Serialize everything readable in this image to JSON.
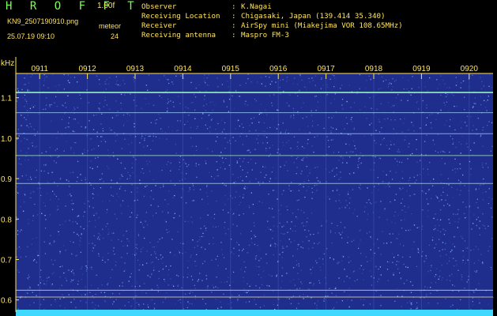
{
  "header": {
    "app_title": "H R O F F T",
    "version": "1.00f",
    "filename": "KN9_2507190910.png",
    "detector": "meteor",
    "timestamp": "25.07.19 09:10",
    "count": "24",
    "info_rows": [
      {
        "label": "Observer",
        "value": "K.Nagai"
      },
      {
        "label": "Receiving Location",
        "value": "Chigasaki, Japan (139.414 35.340)"
      },
      {
        "label": "Receiver",
        "value": "AirSpy mini (Miakejima VOR 108.65MHz)"
      },
      {
        "label": "Receiving antenna",
        "value": "Maspro FM-3"
      }
    ]
  },
  "spectrogram": {
    "unit_label": "kHz",
    "x_ticks": [
      "0911",
      "0912",
      "0913",
      "0914",
      "0915",
      "0916",
      "0917",
      "0918",
      "0919",
      "0920"
    ],
    "y_ticks": [
      "1.1",
      "1.0",
      "0.9",
      "0.8",
      "0.7",
      "0.6"
    ],
    "y_tick_values": [
      1.1,
      1.0,
      0.9,
      0.8,
      0.7,
      0.6
    ],
    "ylim": [
      0.57,
      1.16
    ],
    "xlim": [
      910.5,
      920.5
    ],
    "x_tick_values": [
      911,
      912,
      913,
      914,
      915,
      916,
      917,
      918,
      919,
      920
    ],
    "background_color": "#1F2D8C",
    "speckle_color": "#8FB8FF",
    "carrier_lines": [
      {
        "freq": 1.113,
        "color": "#9BFFB0"
      },
      {
        "freq": 1.063,
        "color": "#A8DFFF"
      },
      {
        "freq": 1.011,
        "color": "#A8DFFF"
      },
      {
        "freq": 0.957,
        "color": "#B8FFC0"
      },
      {
        "freq": 0.888,
        "color": "#C0E8FF"
      },
      {
        "freq": 0.624,
        "color": "#FFEFA0"
      },
      {
        "freq": 0.607,
        "color": "#FFEFA0"
      }
    ],
    "axis_color": "#FFE45A",
    "bottom_bar_color": "#3FD8FF"
  }
}
